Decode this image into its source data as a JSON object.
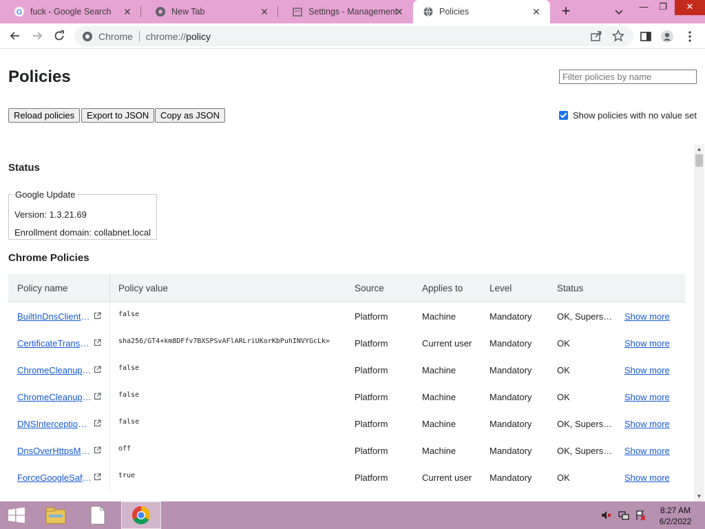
{
  "tabs": [
    {
      "title": "fuck - Google Search",
      "active": false
    },
    {
      "title": "New Tab",
      "active": false
    },
    {
      "title": "Settings - Management",
      "active": false
    },
    {
      "title": "Policies",
      "active": true
    }
  ],
  "window_controls": {
    "minimize": "—",
    "restore": "❐",
    "close": "✕"
  },
  "omnibox": {
    "chip": "Chrome",
    "url_prefix": "chrome://",
    "url_main": "policy"
  },
  "page": {
    "title": "Policies",
    "filter_placeholder": "Filter policies by name",
    "buttons": {
      "reload": "Reload policies",
      "export": "Export to JSON",
      "copy": "Copy as JSON"
    },
    "show_no_value_label": "Show policies with no value set",
    "show_no_value_checked": true
  },
  "status": {
    "title": "Status",
    "legend": "Google Update",
    "version": "Version: 1.3.21.69",
    "enrollment": "Enrollment domain: collabnet.local"
  },
  "chrome_policies": {
    "title": "Chrome Policies",
    "headers": {
      "name": "Policy name",
      "value": "Policy value",
      "source": "Source",
      "applies": "Applies to",
      "level": "Level",
      "status": "Status"
    },
    "rows": [
      {
        "name": "BuiltInDnsClientE…",
        "value": "false",
        "source": "Platform",
        "applies": "Machine",
        "level": "Mandatory",
        "status": "OK, Supers…",
        "more": "Show more"
      },
      {
        "name": "CertificateTransp…",
        "value": "sha256/GT4+km8DFfv7BXSPSvAFlARLriUKorKbPuhINVYGcLk=",
        "source": "Platform",
        "applies": "Current user",
        "level": "Mandatory",
        "status": "OK",
        "more": "Show more"
      },
      {
        "name": "ChromeCleanupE…",
        "value": "false",
        "source": "Platform",
        "applies": "Machine",
        "level": "Mandatory",
        "status": "OK",
        "more": "Show more"
      },
      {
        "name": "ChromeCleanupR…",
        "value": "false",
        "source": "Platform",
        "applies": "Machine",
        "level": "Mandatory",
        "status": "OK",
        "more": "Show more"
      },
      {
        "name": "DNSInterception…",
        "value": "false",
        "source": "Platform",
        "applies": "Machine",
        "level": "Mandatory",
        "status": "OK, Supers…",
        "more": "Show more"
      },
      {
        "name": "DnsOverHttpsMo…",
        "value": "off",
        "source": "Platform",
        "applies": "Machine",
        "level": "Mandatory",
        "status": "OK, Supers…",
        "more": "Show more"
      },
      {
        "name": "ForceGoogleSafe…",
        "value": "true",
        "source": "Platform",
        "applies": "Current user",
        "level": "Mandatory",
        "status": "OK",
        "more": "Show more"
      }
    ]
  },
  "taskbar": {
    "time": "8:27 AM",
    "date": "6/2/2022"
  },
  "colors": {
    "tabstrip": "#e7a3d3",
    "taskbar": "#b890b0",
    "link": "#1558d6",
    "checkbox": "#1a73e8"
  }
}
